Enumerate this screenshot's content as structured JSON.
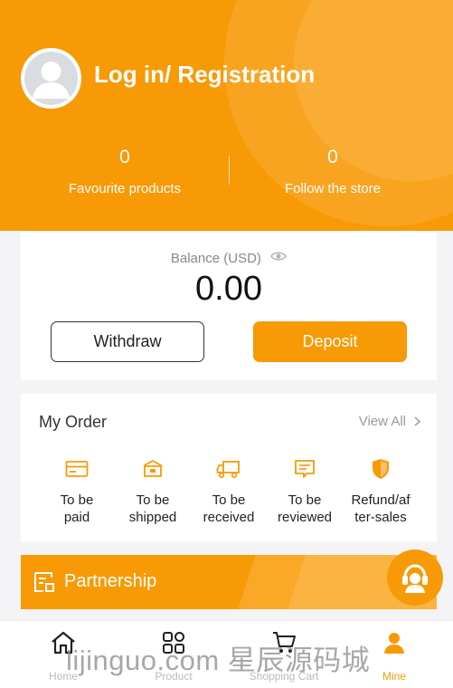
{
  "header": {
    "login_title": "Log in/ Registration",
    "favourites": {
      "count": "0",
      "label": "Favourite products"
    },
    "follows": {
      "count": "0",
      "label": "Follow the store"
    }
  },
  "balance": {
    "label": "Balance",
    "currency": "(USD)",
    "amount": "0.00",
    "withdraw_label": "Withdraw",
    "deposit_label": "Deposit"
  },
  "orders": {
    "title": "My Order",
    "view_all": "View All",
    "items": [
      {
        "line1": "To be",
        "line2": "paid",
        "icon": "card-icon"
      },
      {
        "line1": "To be",
        "line2": "shipped",
        "icon": "box-icon"
      },
      {
        "line1": "To be",
        "line2": "received",
        "icon": "truck-icon"
      },
      {
        "line1": "To be",
        "line2": "reviewed",
        "icon": "review-icon"
      },
      {
        "line1": "Refund/af",
        "line2": "ter-sales",
        "icon": "shield-icon"
      }
    ]
  },
  "partnership": {
    "label": "Partnership"
  },
  "tabbar": {
    "items": [
      {
        "label": "Home",
        "icon": "home-icon"
      },
      {
        "label": "Product",
        "icon": "grid-icon"
      },
      {
        "label": "Shopping Cart",
        "icon": "cart-icon"
      },
      {
        "label": "Mine",
        "icon": "person-icon",
        "active": true
      }
    ]
  },
  "watermark": "lijinguo.com 星辰源码城",
  "colors": {
    "accent": "#f79a06",
    "text": "#222222",
    "muted": "#999999"
  }
}
